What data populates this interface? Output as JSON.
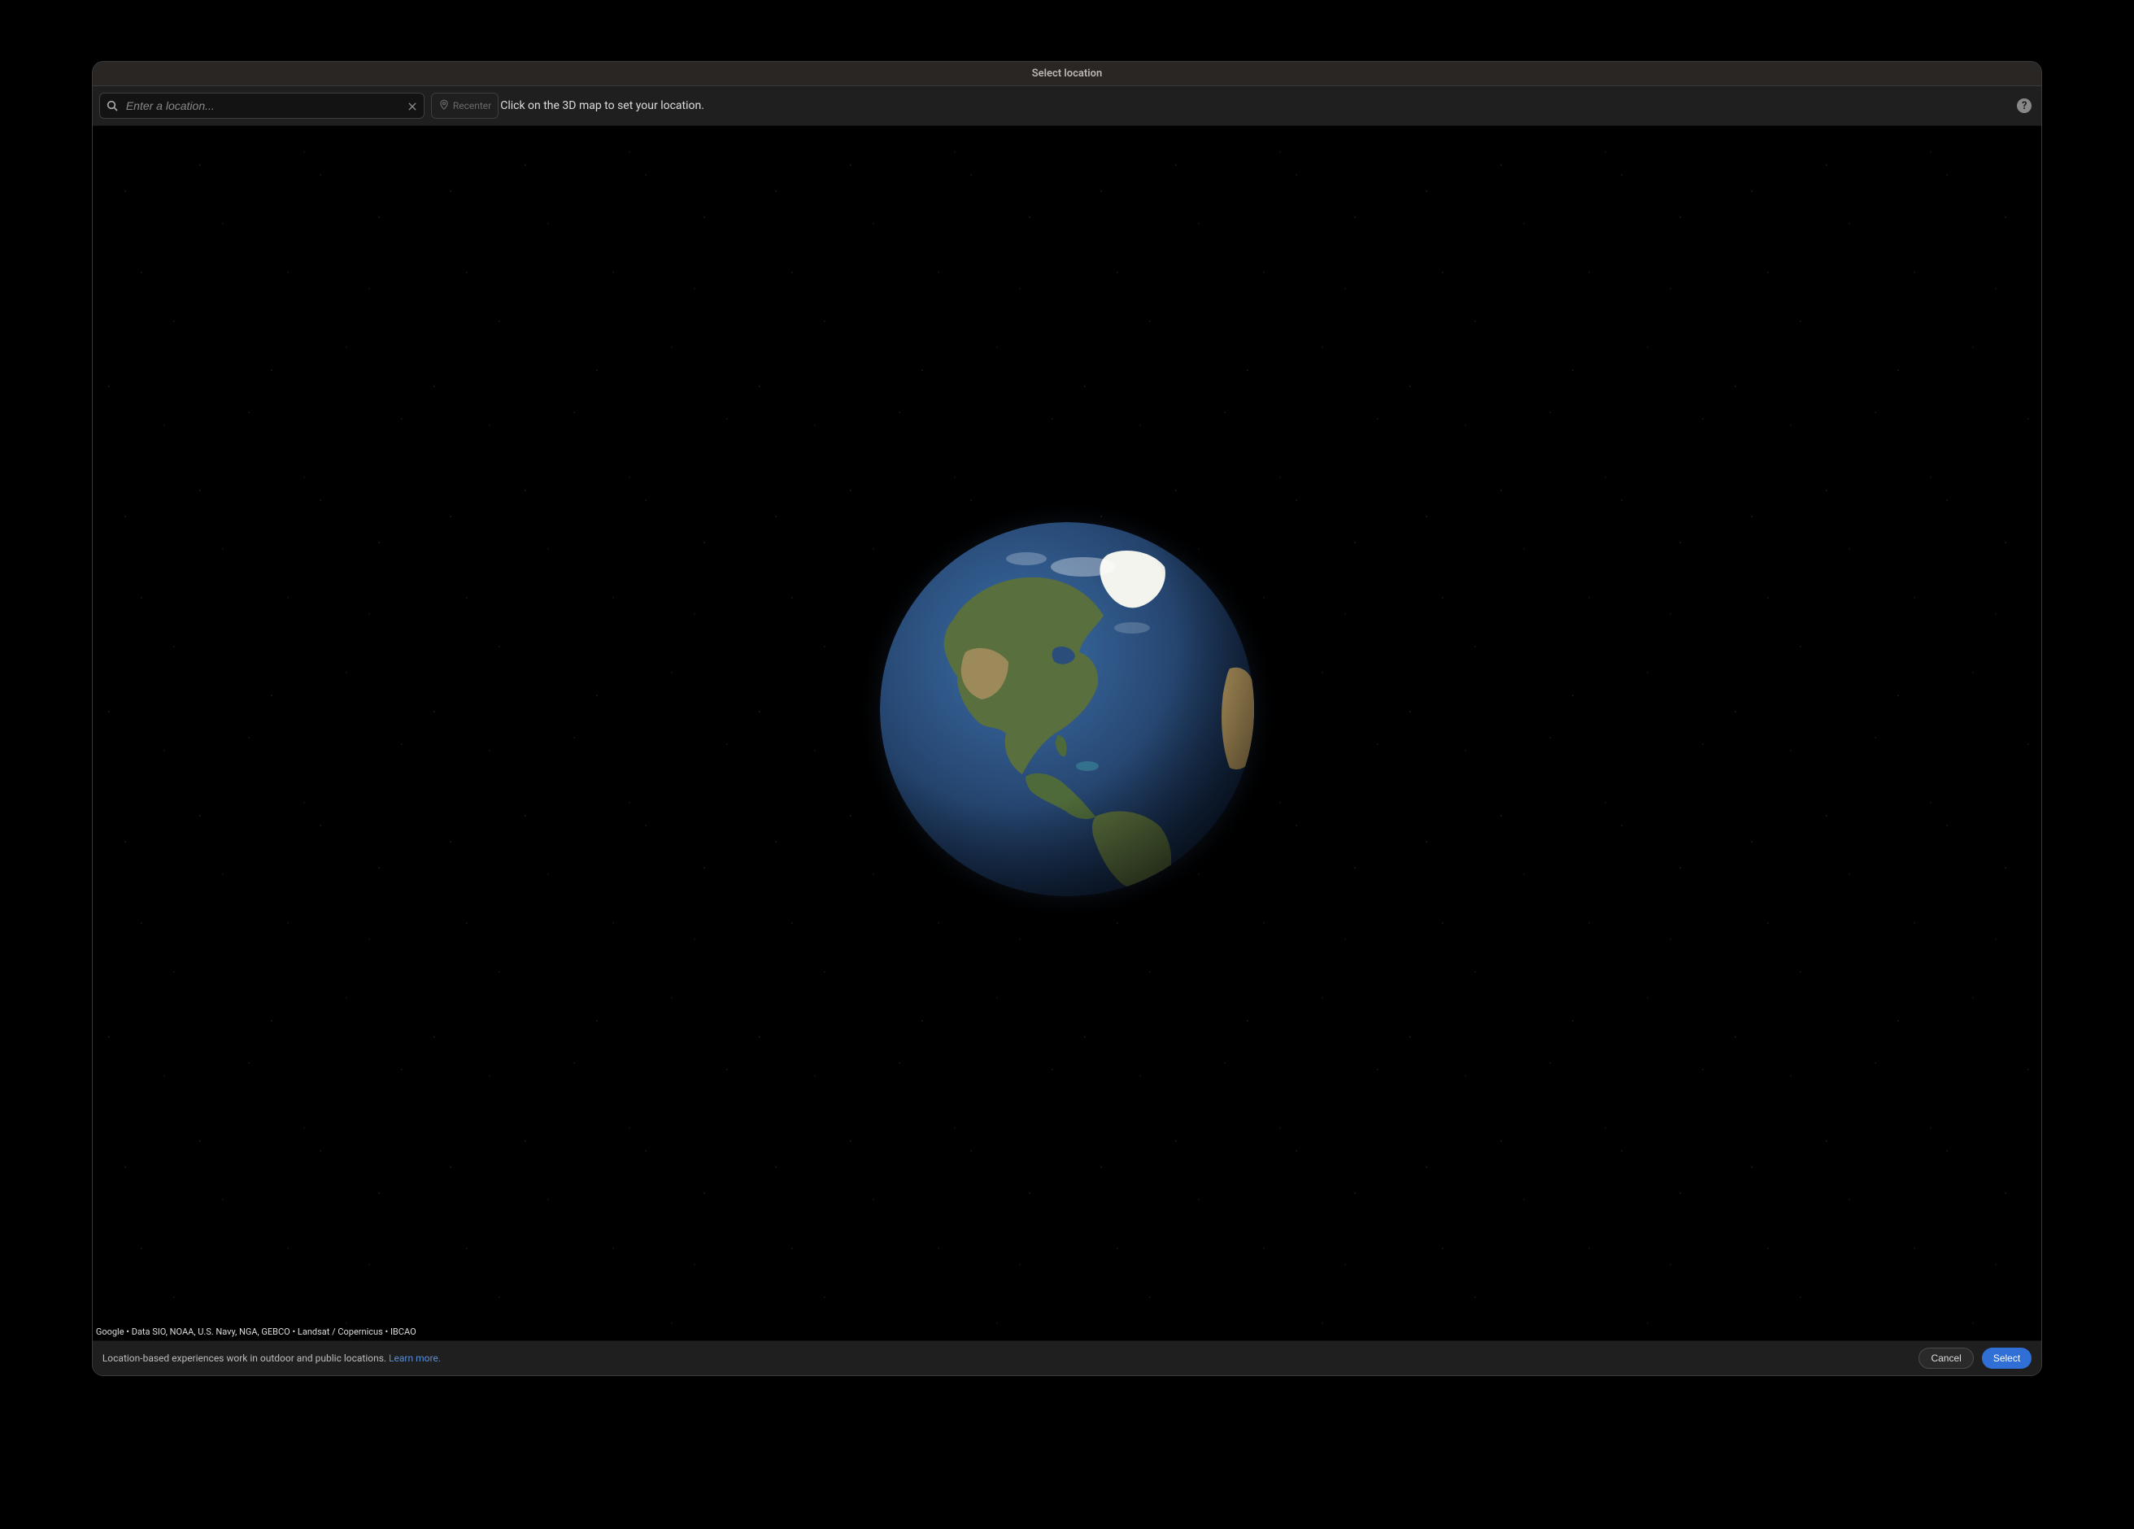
{
  "window": {
    "title": "Select location"
  },
  "toolbar": {
    "search_placeholder": "Enter a location...",
    "recenter_label": "Recenter",
    "hint": "Click on the 3D map to set your location.",
    "help_glyph": "?"
  },
  "map": {
    "attribution": "Google • Data SIO, NOAA, U.S. Navy, NGA, GEBCO • Landsat / Copernicus • IBCAO"
  },
  "footer": {
    "info_text": "Location-based experiences work in outdoor and public locations.  ",
    "learn_more_label": "Learn more.",
    "cancel_label": "Cancel",
    "select_label": "Select"
  }
}
